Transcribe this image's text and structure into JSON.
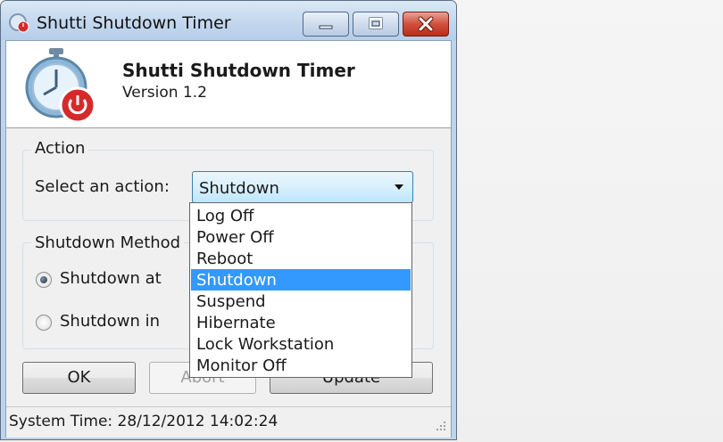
{
  "window": {
    "title": "Shutti Shutdown Timer",
    "controls": {
      "minimize": "minimize-icon",
      "maximize": "maximize-icon",
      "close": "close-icon"
    }
  },
  "header": {
    "app_name": "Shutti Shutdown Timer",
    "version": "Version 1.2"
  },
  "action_group": {
    "title": "Action",
    "select_label": "Select an action:",
    "selected": "Shutdown",
    "options": [
      "Log Off",
      "Power Off",
      "Reboot",
      "Shutdown",
      "Suspend",
      "Hibernate",
      "Lock Workstation",
      "Monitor Off"
    ],
    "highlighted_index": 3
  },
  "method_group": {
    "title": "Shutdown Method",
    "options": [
      {
        "label": "Shutdown at",
        "checked": true
      },
      {
        "label": "Shutdown in",
        "checked": false
      }
    ]
  },
  "buttons": {
    "ok": "OK",
    "abort": "Abort",
    "update": "Update"
  },
  "status": {
    "system_time": "System Time: 28/12/2012 14:02:24"
  },
  "colors": {
    "selection": "#3399ff",
    "close_button": "#c7412d",
    "titlebar": "#c3d7ee"
  }
}
